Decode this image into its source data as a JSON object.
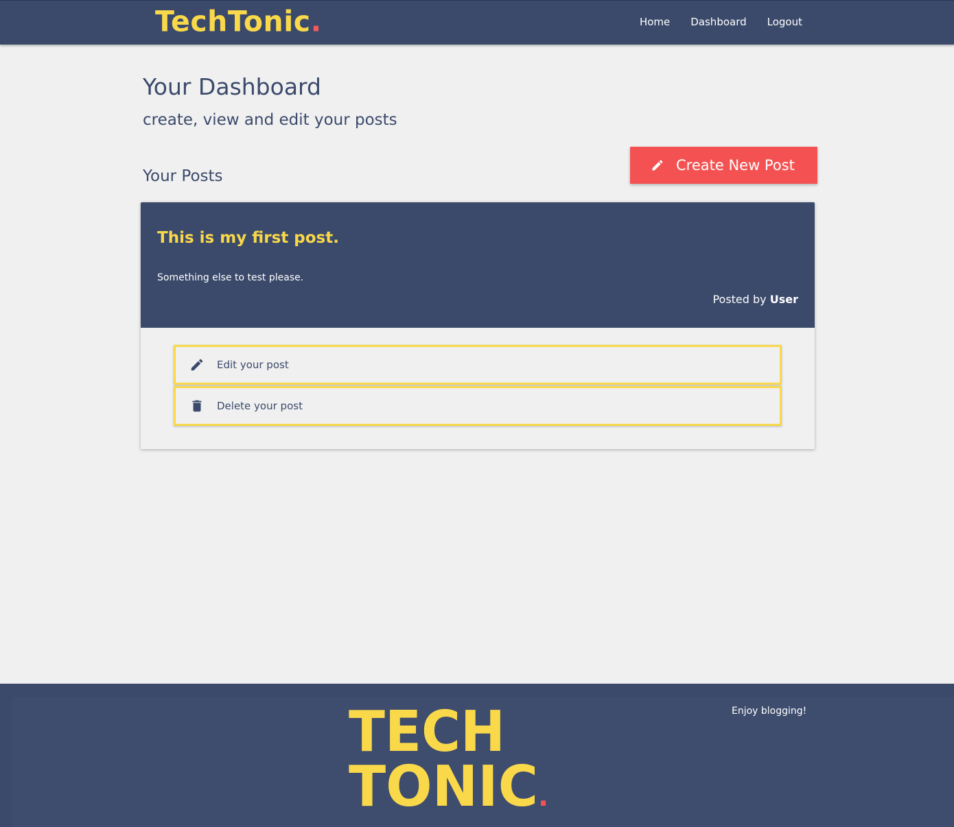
{
  "nav": {
    "brand": "TechTonic",
    "brand_dot": ".",
    "links": [
      "Home",
      "Dashboard",
      "Logout"
    ]
  },
  "dashboard": {
    "title": "Your Dashboard",
    "subtitle": "create, view and edit your posts",
    "posts_heading": "Your Posts",
    "create_button": "Create New Post"
  },
  "post": {
    "title": "This is my first post.",
    "body": "Something else to test please.",
    "posted_by_prefix": "Posted by ",
    "author": "User",
    "actions": {
      "edit": "Edit your post",
      "delete": "Delete your post"
    }
  },
  "footer": {
    "logo_line1": "TECH",
    "logo_line2": "TONIC",
    "logo_dot": ".",
    "tagline": "Enjoy blogging!"
  },
  "colors": {
    "navy": "#3b4a6b",
    "yellow": "#f9d84a",
    "red": "#f45252",
    "background": "#f0f0f0"
  }
}
